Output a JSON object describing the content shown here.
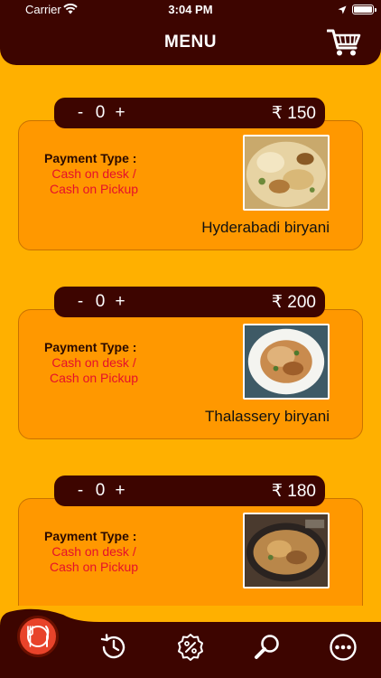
{
  "status_bar": {
    "carrier": "Carrier",
    "time": "3:04 PM"
  },
  "header": {
    "title": "MENU"
  },
  "icons": {
    "cart": "cart-icon",
    "menu_tab": "restaurant-icon",
    "history_tab": "history-icon",
    "offers_tab": "discount-icon",
    "search_tab": "search-icon",
    "more_tab": "more-icon"
  },
  "colors": {
    "bar": "#3D0500",
    "background": "#FFB000",
    "card": "#FF9800",
    "payment_value": "#E5102B",
    "active_tab": "#E8432A"
  },
  "menu": {
    "items": [
      {
        "minus": "-",
        "qty": "0",
        "plus": "+",
        "price": "₹ 150",
        "payment_label": "Payment Type :",
        "payment_line1": "Cash on desk /",
        "payment_line2": "Cash on Pickup",
        "name": "Hyderabadi biryani"
      },
      {
        "minus": "-",
        "qty": "0",
        "plus": "+",
        "price": "₹ 200",
        "payment_label": "Payment Type :",
        "payment_line1": "Cash on desk /",
        "payment_line2": "Cash on Pickup",
        "name": "Thalassery biryani"
      },
      {
        "minus": "-",
        "qty": "0",
        "plus": "+",
        "price": "₹ 180",
        "payment_label": "Payment Type :",
        "payment_line1": "Cash on desk /",
        "payment_line2": "Cash on Pickup",
        "name": ""
      }
    ]
  }
}
